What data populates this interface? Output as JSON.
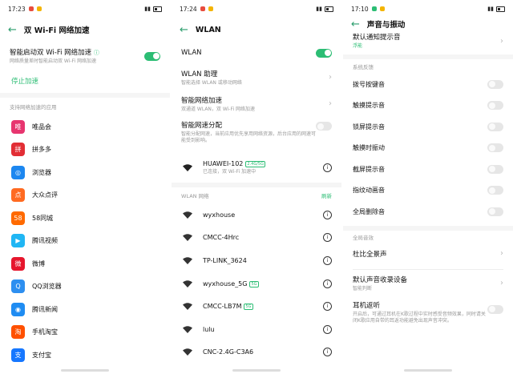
{
  "colors": {
    "accent": "#2cbd74",
    "back": "#2a9d6c"
  },
  "p1": {
    "time": "17:23",
    "title": "双 Wi-Fi 网络加速",
    "smart_label": "智能启动双 Wi-Fi 网络加速",
    "smart_sub": "网络质量差时智能启动双 Wi-Fi 网络加速",
    "stop_label": "停止加速",
    "section": "支持网络加速的应用",
    "apps": [
      {
        "name": "唯品会",
        "icon": "vip-icon",
        "color": "#e7356f",
        "glyph": "唯"
      },
      {
        "name": "拼多多",
        "icon": "pinduoduo-icon",
        "color": "#e22e35",
        "glyph": "拼"
      },
      {
        "name": "浏览器",
        "icon": "browser-icon",
        "color": "#1c87f0",
        "glyph": "◎"
      },
      {
        "name": "大众点评",
        "icon": "dianping-icon",
        "color": "#ff6a21",
        "glyph": "点"
      },
      {
        "name": "58同城",
        "icon": "58-icon",
        "color": "#ff6a00",
        "glyph": "58"
      },
      {
        "name": "腾讯视频",
        "icon": "tencent-video-icon",
        "color": "#20b6f4",
        "glyph": "▶"
      },
      {
        "name": "微博",
        "icon": "weibo-icon",
        "color": "#e6162d",
        "glyph": "微"
      },
      {
        "name": "QQ浏览器",
        "icon": "qq-browser-icon",
        "color": "#2d8ff0",
        "glyph": "Q"
      },
      {
        "name": "腾讯新闻",
        "icon": "tencent-news-icon",
        "color": "#1f8cf2",
        "glyph": "◉"
      },
      {
        "name": "手机淘宝",
        "icon": "taobao-icon",
        "color": "#ff5000",
        "glyph": "淘"
      },
      {
        "name": "支付宝",
        "icon": "alipay-icon",
        "color": "#1677ff",
        "glyph": "支"
      }
    ]
  },
  "p2": {
    "time": "17:24",
    "title": "WLAN",
    "wlan_label": "WLAN",
    "assist_label": "WLAN 助理",
    "assist_sub": "智能选择 WLAN 或移动网络",
    "accel_label": "智能网络加速",
    "accel_sub": "双通道 WLAN，双 Wi-Fi 网络加速",
    "speed_label": "智能网速分配",
    "speed_sub": "智能分配网速，当前应用优先享用网络资源，后台应用的网速可能受到影响。",
    "connected_name": "HUAWEI-102",
    "connected_badge": "2.4G/5G",
    "connected_sub": "已连接，双 Wi-Fi 加速中",
    "networks_header": "WLAN 网络",
    "refresh": "刷新",
    "networks": [
      {
        "name": "wyxhouse",
        "badge": ""
      },
      {
        "name": "CMCC-4Hrc",
        "badge": ""
      },
      {
        "name": "TP-LINK_3624",
        "badge": ""
      },
      {
        "name": "wyxhouse_5G",
        "badge": "5G"
      },
      {
        "name": "CMCC-LB7M",
        "badge": "5G"
      },
      {
        "name": "lulu",
        "badge": ""
      },
      {
        "name": "CNC-2.4G-C3A6",
        "badge": ""
      }
    ]
  },
  "p3": {
    "time": "17:10",
    "title": "声音与振动",
    "notif_label": "默认通知提示音",
    "notif_value": "浮能",
    "sys_header": "系统反馈",
    "sys_items": [
      "拨号按键音",
      "触摸提示音",
      "锁屏提示音",
      "触摸时振动",
      "截屏提示音",
      "指纹动画音",
      "全局删除音"
    ],
    "global_header": "全局音效",
    "dolby_label": "杜比全景声",
    "rec_label": "默认声音收录设备",
    "rec_sub": "智能判断",
    "ear_label": "耳机返听",
    "ear_sub": "开启后，可通过耳机在K歌过程中实时感受音频效果，同时请关闭K歌应用自带的耳返功能避免出现声音冲突。"
  }
}
